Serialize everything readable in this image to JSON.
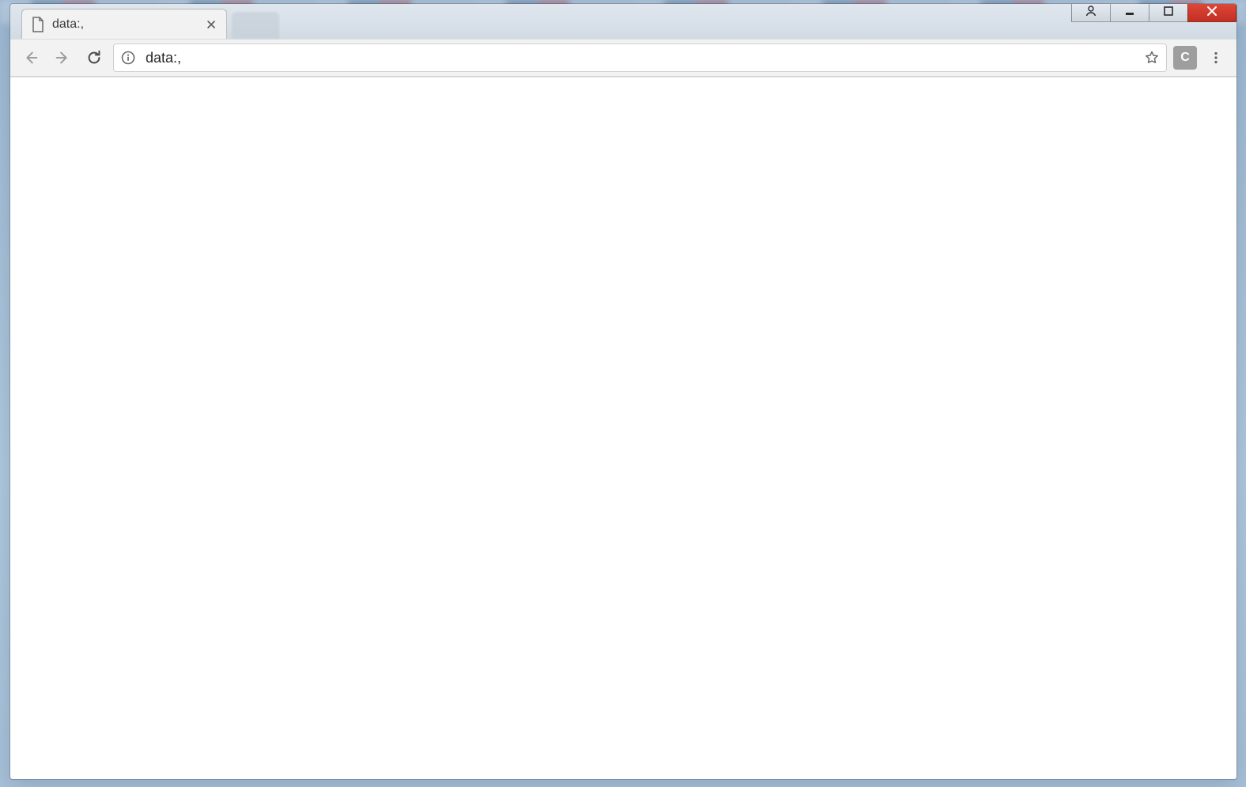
{
  "window": {
    "user_button_label": "",
    "minimize_label": "",
    "maximize_label": "",
    "close_label": ""
  },
  "tabs": {
    "active": {
      "title": "data:,",
      "favicon": "file-icon"
    }
  },
  "toolbar": {
    "back_enabled": false,
    "forward_enabled": false,
    "reload_enabled": true,
    "extension_letter": "C"
  },
  "omnibox": {
    "security_icon": "info-icon",
    "url": "data:,",
    "placeholder": ""
  },
  "page": {
    "body": ""
  }
}
